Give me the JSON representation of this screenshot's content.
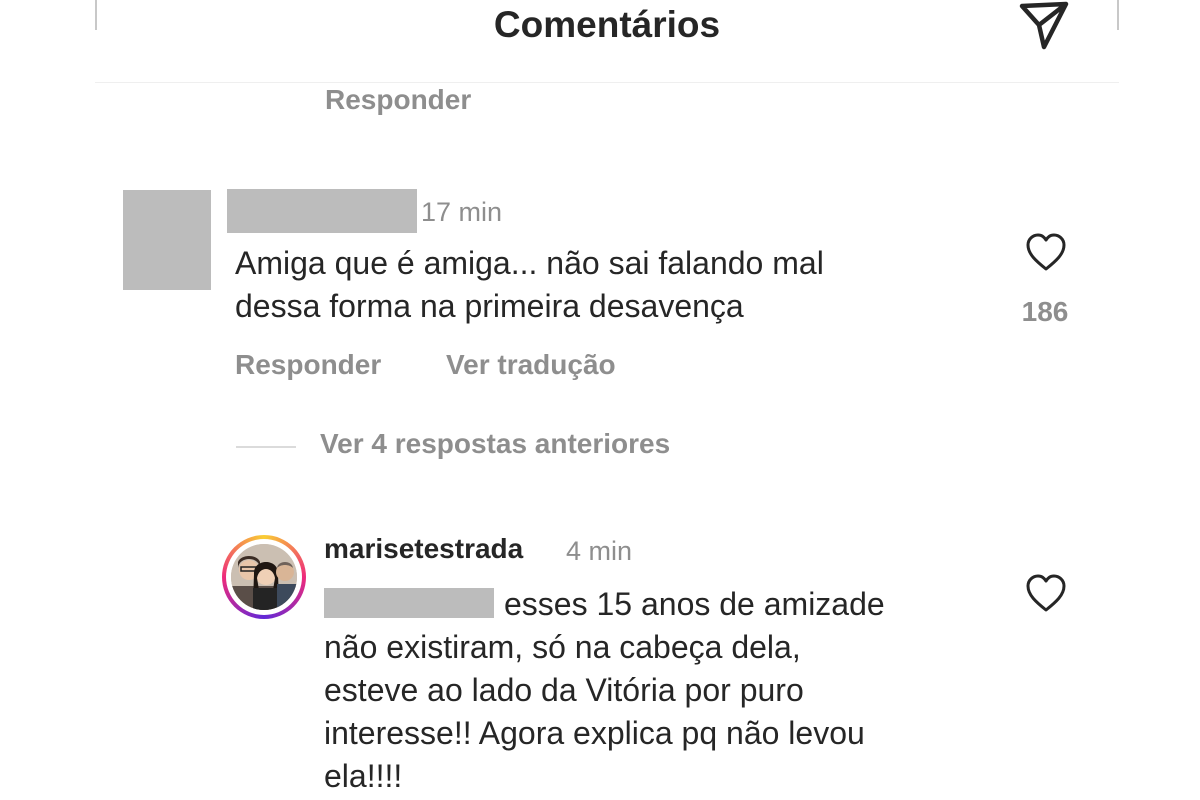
{
  "header": {
    "title": "Comentários",
    "send_icon": "paper-plane-icon"
  },
  "top_comment_tail": {
    "reply_label": "Responder"
  },
  "comment": {
    "avatar": "redacted",
    "username": "redacted",
    "time": "17 min",
    "text_line1": "Amiga que é amiga... não sai falando mal",
    "text_line2": "dessa forma na primeira desavença",
    "like_icon": "heart-outline-icon",
    "likes": "186",
    "reply_label": "Responder",
    "translate_label": "Ver tradução"
  },
  "replies": {
    "view_previous_label": "Ver 4 respostas anteriores"
  },
  "reply": {
    "username": "marisetestrada",
    "time": "4 min",
    "mention": "redacted",
    "text_line1": "esses 15 anos de amizade",
    "text_line2": "não existiram, só na cabeça dela,",
    "text_line3": "esteve ao lado da Vitória por puro",
    "text_line4": "interesse!! Agora explica pq não levou",
    "text_line5": "ela!!!!",
    "like_icon": "heart-outline-icon"
  },
  "colors": {
    "text": "#262626",
    "secondary": "#8e8e8e",
    "redaction": "#bcbcbc",
    "divider": "#efefef"
  }
}
